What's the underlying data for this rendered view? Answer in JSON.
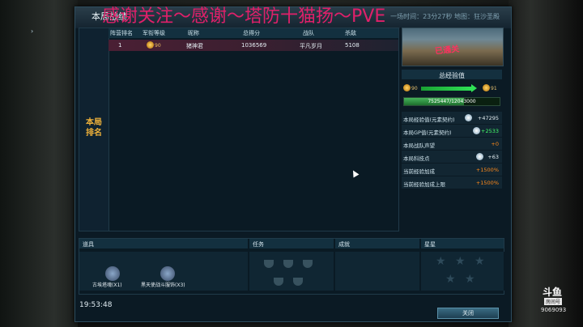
{
  "window": {
    "title": "本局战绩",
    "header_right": "一场时间：23分27秒",
    "header_right2": "地图：狂沙圣殿",
    "overlay_text": "感谢关注～感谢～塔防十猫扬～PVE"
  },
  "ranking": {
    "side_label_line1": "本局",
    "side_label_line2": "排名",
    "columns": [
      "阵营排名",
      "军衔等级",
      "昵称",
      "总得分",
      "战队",
      "杀敌"
    ],
    "rows": [
      {
        "rank": "1",
        "military_level": "90",
        "nickname": "猪神君",
        "score": "1036569",
        "team": "平凡岁月",
        "kills": "5108"
      }
    ]
  },
  "result_panel": {
    "stamp": "已通关",
    "exp_title": "总经验值",
    "level_from": "90",
    "level_to": "91",
    "exp_progress": "7525447/12043000",
    "exp_fraction": 0.625,
    "stats": [
      {
        "label": "本局经验值(元素契约)",
        "value": "+47295",
        "color": "white"
      },
      {
        "label": "本局GP值(元素契约)",
        "value": "+2533",
        "color": "green"
      },
      {
        "label": "本局战队声望",
        "value": "+0",
        "color": "orange"
      },
      {
        "label": "本局科技点",
        "value": "+63",
        "color": "white"
      },
      {
        "label": "当前经验加成",
        "value": "+1500%",
        "color": "orange"
      },
      {
        "label": "当前经验加成上限",
        "value": "+1500%",
        "color": "orange"
      }
    ]
  },
  "bottom": {
    "items_label": "道具",
    "tasks_label": "任务",
    "achievements_label": "成就",
    "stars_label": "星星",
    "items": [
      {
        "name": "古埃塔魂(X1)"
      },
      {
        "name": "黑天使战斗服饰(X3)"
      }
    ],
    "stars_count": 5
  },
  "footer": {
    "time": "19:53:48",
    "close_button": "关闭"
  },
  "watermark": {
    "logo": "斗鱼",
    "sub": "房间号",
    "room": "9069093"
  }
}
